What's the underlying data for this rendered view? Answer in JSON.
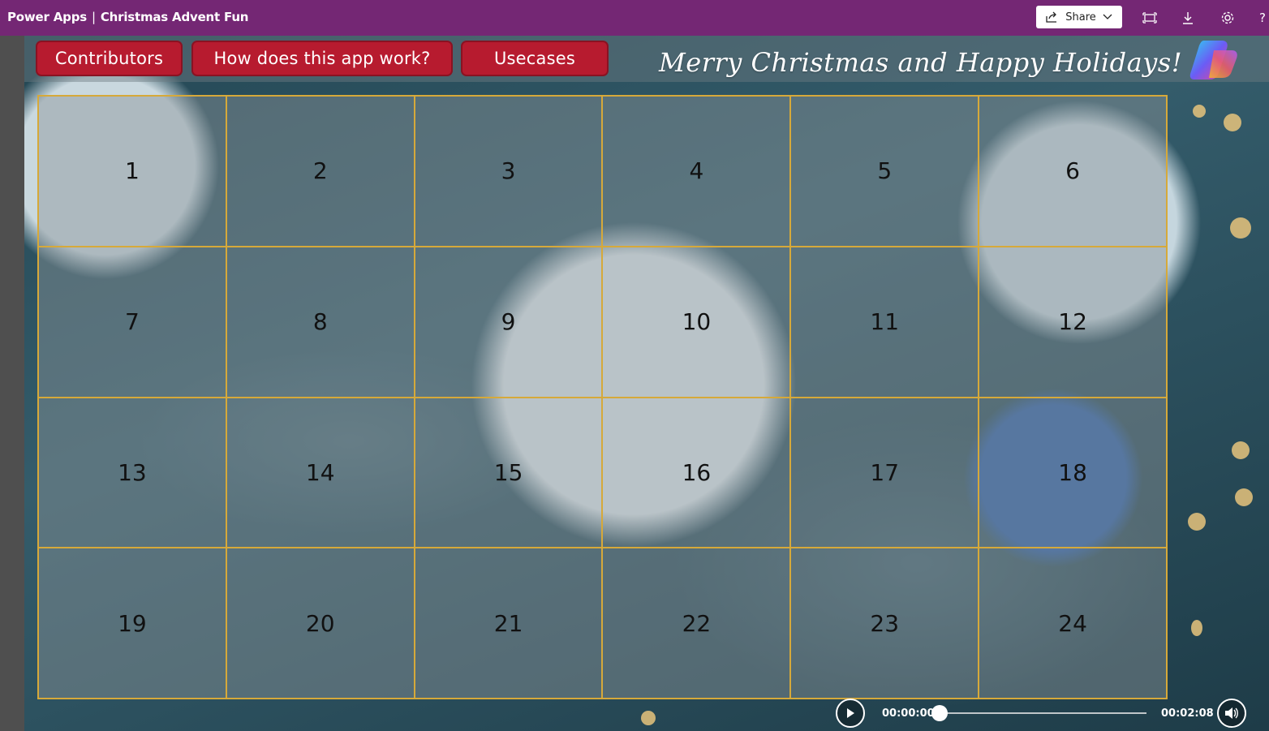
{
  "window": {
    "app_name": "Power Apps",
    "separator": "|",
    "app_title": "Christmas Advent Fun",
    "share_label": "Share",
    "toolbar_icons": [
      "fit-to-window-icon",
      "download-icon",
      "settings-icon",
      "help-icon"
    ]
  },
  "header": {
    "buttons": [
      {
        "label": "Contributors"
      },
      {
        "label": "How does this app work?"
      },
      {
        "label": "Usecases"
      }
    ],
    "greeting": "Merry Christmas and Happy Holidays!",
    "button_color": "#b71b2f"
  },
  "calendar": {
    "days": [
      "1",
      "2",
      "3",
      "4",
      "5",
      "6",
      "7",
      "8",
      "9",
      "10",
      "11",
      "12",
      "13",
      "14",
      "15",
      "16",
      "17",
      "18",
      "19",
      "20",
      "21",
      "22",
      "23",
      "24"
    ],
    "grid_color": "#d6a93a"
  },
  "player": {
    "current_time": "00:00:00",
    "total_time": "00:02:08",
    "progress": 0
  },
  "colors": {
    "topbar": "#742774",
    "accent": "#b71b2f"
  }
}
